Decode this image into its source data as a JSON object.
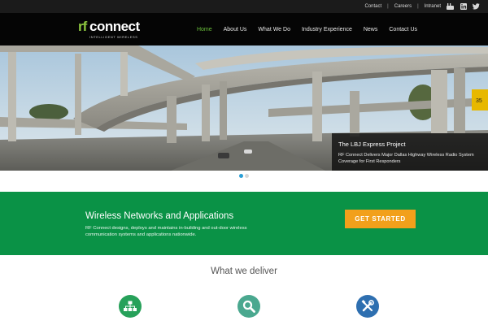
{
  "topbar": {
    "links": [
      "Contact",
      "Careers",
      "Intranet"
    ],
    "separator": "|",
    "social_icons": [
      "youtube-icon",
      "linkedin-icon",
      "twitter-icon"
    ]
  },
  "brand": {
    "mark": "rf",
    "name": "connect",
    "tagline": "INTELLIGENT WIRELESS"
  },
  "nav": {
    "items": [
      "Home",
      "About Us",
      "What We Do",
      "Industry Experience",
      "News",
      "Contact Us"
    ],
    "active": "Home"
  },
  "hero": {
    "caption_title": "The LBJ Express Project",
    "caption_text": "RF Connect Delivers Major Dallas Highway Wireless Radio System Coverage for First Responders",
    "slide_count": 2,
    "active_slide": 1
  },
  "band": {
    "title": "Wireless Networks and Applications",
    "text": "RF Connect designs, deploys and maintains in-building and out-door wireless communication systems and applications nationwide.",
    "cta_label": "GET STARTED"
  },
  "deliver": {
    "title": "What we deliver",
    "icons": [
      "network-icon",
      "search-icon",
      "tools-icon"
    ]
  },
  "colors": {
    "green_band": "#0a9246",
    "accent_orange": "#f2a01b",
    "nav_active": "#6abf3b",
    "slider_active": "#2a9fd6"
  }
}
